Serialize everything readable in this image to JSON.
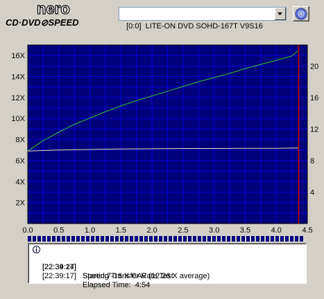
{
  "app": {
    "logo_top": "nero",
    "logo_bottom": "CD·DVD⊘SPEED"
  },
  "toolbar": {
    "drive_selected": "[0:0]  LITE-ON DVD SOHD-167T V9S16"
  },
  "colors": {
    "plot_bg": "#00007a",
    "grid": "#0000e0",
    "speed_line": "#32c832",
    "rpm_line": "#e6e6a0",
    "marker": "#d00000",
    "progress_segment": "#000080",
    "window": "#d4d0c8"
  },
  "chart_data": {
    "type": "line",
    "x_ticks": [
      "0.0",
      "0.5",
      "1.0",
      "1.5",
      "2.0",
      "2.5",
      "3.0",
      "3.5",
      "4.0",
      "4.5"
    ],
    "y_left_ticks": [
      "2X",
      "4X",
      "6X",
      "8X",
      "10X",
      "12X",
      "14X",
      "16X"
    ],
    "y_right_ticks": [
      "4",
      "8",
      "12",
      "16",
      "20"
    ],
    "xlim": [
      0,
      4.5
    ],
    "ylim_left": [
      0,
      17
    ],
    "ylim_right": [
      0,
      22.67
    ],
    "grid": true,
    "end_marker_x": 4.36,
    "series": [
      {
        "x": [
          0,
          0.25,
          0.5,
          0.75,
          1.0,
          1.25,
          1.5,
          1.75,
          2.0,
          2.25,
          2.5,
          2.75,
          3.0,
          3.25,
          3.5,
          3.75,
          4.0,
          4.25,
          4.36
        ],
        "y": [
          6.9,
          7.9,
          8.7,
          9.45,
          10.05,
          10.65,
          11.2,
          11.7,
          12.15,
          12.6,
          13.05,
          13.5,
          13.9,
          14.3,
          14.75,
          15.15,
          15.55,
          15.95,
          16.5
        ]
      },
      {
        "x": [
          0,
          0.5,
          1.0,
          1.5,
          2.0,
          2.5,
          3.0,
          3.5,
          4.0,
          4.36
        ],
        "y": [
          6.9,
          7.0,
          7.05,
          7.1,
          7.12,
          7.15,
          7.15,
          7.17,
          7.17,
          7.2
        ]
      }
    ]
  },
  "log": [
    {
      "time": "[22:34:24]",
      "message": "Starting Transfer Rate Test"
    },
    {
      "time": "[22:39:17]",
      "message": "Speed:7-16 X CAV (12.26 X average)"
    },
    {
      "time": "[22:39:17]",
      "message": "Elapsed Time:  4:54"
    }
  ],
  "progress": {
    "fraction": 1.0
  }
}
